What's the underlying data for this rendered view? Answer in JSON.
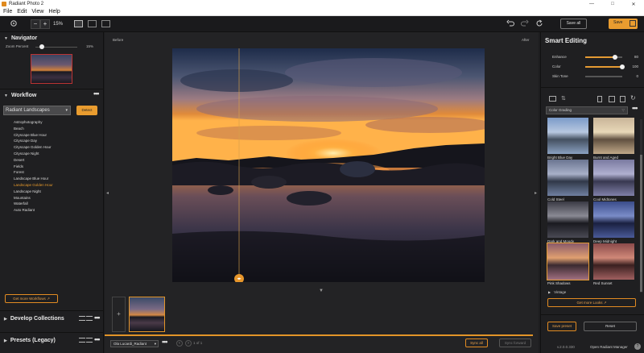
{
  "app": {
    "title": "Radiant Photo 2"
  },
  "window_controls": {
    "minimize": "—",
    "maximize": "□",
    "close": "✕"
  },
  "menu": [
    "File",
    "Edit",
    "View",
    "Help"
  ],
  "toolbar": {
    "zoom_minus": "−",
    "zoom_plus": "+",
    "zoom_value": "15%",
    "save_all_label": "Save all",
    "save_label": "Save",
    "icons": [
      "settings-icon",
      "undo-icon",
      "redo-icon",
      "reset-icon",
      "grid-view-icon",
      "compare-view-icon",
      "split-view-icon"
    ]
  },
  "navigator": {
    "title": "Navigator",
    "zoom_label": "Zoom Percent",
    "zoom_value": "15%",
    "zoom_fraction": 0.15
  },
  "workflow": {
    "title": "Workflow",
    "selected_workflow": "Radiant Landscapes",
    "detect_label": "Detect",
    "items": [
      "Astrophotography",
      "Beach",
      "Cityscape Blue Hour",
      "Cityscape Day",
      "Cityscape Golden Hour",
      "Cityscape Night",
      "Desert",
      "Fields",
      "Forest",
      "Landscape Blue Hour",
      "Landscape Golden Hour",
      "Landscape Night",
      "Mountains",
      "Waterfall",
      "Auto Radiant"
    ],
    "active_item": "Landscape Golden Hour",
    "get_more_label": "Get more Workflows"
  },
  "develop_collections": {
    "title": "Develop Collections"
  },
  "presets": {
    "title": "Presets (Legacy)"
  },
  "canvas": {
    "before_label": "Before",
    "after_label": "After",
    "filename": "Ola Lucardi_Radiant",
    "page_info": "1 of 1",
    "sync_all_label": "Sync all",
    "sync_forward_label": "Sync forward",
    "add_label": "+",
    "split_handle": "◂▸"
  },
  "smart_editing": {
    "title": "Smart Editing",
    "sliders": [
      {
        "label": "Enhance",
        "value": "80",
        "fraction": 0.8
      },
      {
        "label": "Color",
        "value": "100",
        "fraction": 1.0
      },
      {
        "label": "Skin Tone",
        "value": "0",
        "fraction": 0.0
      }
    ]
  },
  "looks": {
    "category": "Color Grading",
    "items": [
      {
        "label": "Bright Blue Day",
        "selected": false
      },
      {
        "label": "Burnt and Aged",
        "selected": false
      },
      {
        "label": "Cold Steel",
        "selected": false
      },
      {
        "label": "Cool Midtones",
        "selected": false
      },
      {
        "label": "Dark and Moody",
        "selected": false
      },
      {
        "label": "Deep Midnight",
        "selected": false
      },
      {
        "label": "Pink Shadows",
        "selected": true
      },
      {
        "label": "Red Sunset",
        "selected": false
      }
    ],
    "vintage_label": "Vintage",
    "get_more_label": "Get more Looks"
  },
  "footer_right": {
    "save_preset_label": "Save preset",
    "reset_label": "Reset",
    "version": "v.2.0.0.330",
    "manager_label": "Open Radiant Manager",
    "help": "?"
  },
  "colors": {
    "accent": "#e99c2f",
    "panel": "#1f1f21",
    "canvas": "#232325"
  }
}
